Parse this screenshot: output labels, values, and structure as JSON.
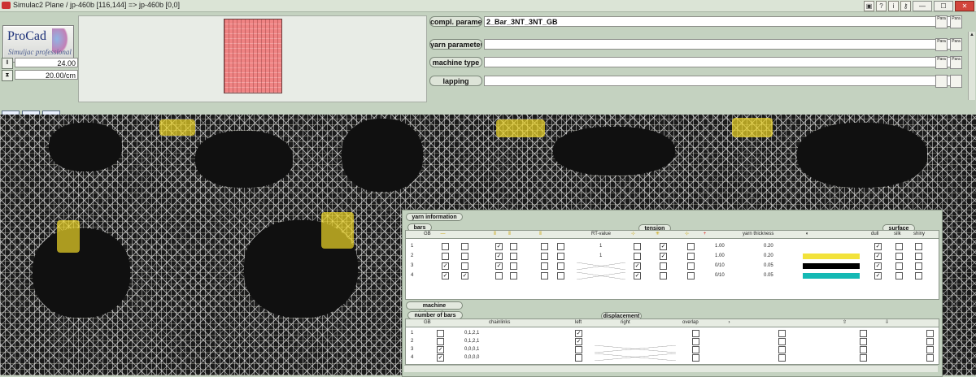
{
  "window": {
    "title": "Simulac2 Plane  / jp-460b [116,144] => jp-460b [0,0]",
    "toolbar_icons": [
      "save-icon",
      "help-icon",
      "info-icon",
      "key-icon"
    ],
    "buttons": {
      "minimize": "—",
      "maximize": "☐",
      "close": "✕"
    }
  },
  "logo": {
    "name": "ProCad",
    "subtitle": "Simuljac professional"
  },
  "params": [
    {
      "icon": "wale-icon",
      "value": "24.00"
    },
    {
      "icon": "course-icon",
      "value": "20.00/cm"
    }
  ],
  "fields": [
    {
      "label": "compl. parameter",
      "value": "2_Bar_3NT_3NT_GB"
    },
    {
      "label": "yarn parameter",
      "value": ""
    },
    {
      "label": "machine type",
      "value": ""
    },
    {
      "label": "lapping",
      "value": ""
    }
  ],
  "file_buttons": {
    "open": "Para",
    "save": "Para"
  },
  "tools": [
    "stitch-view-icon",
    "bars-icon",
    "settings-gear-icon"
  ],
  "yarn_information": {
    "tab": "yarn information",
    "subtab": "bars",
    "group_tension": "tension",
    "group_surface": "surface",
    "headers": {
      "gb": "GB",
      "runin": "RT-value",
      "thickness": "yarn thickness",
      "dull": "dull",
      "silk": "silk",
      "shiny": "shiny"
    },
    "rows": [
      {
        "n": "1",
        "runin": "1",
        "tension": "1.00",
        "thick": "0.20",
        "color": "#ffffff"
      },
      {
        "n": "2",
        "runin": "1",
        "tension": "1.00",
        "thick": "0.20",
        "color": "#f2e23a"
      },
      {
        "n": "3",
        "runin": "",
        "tension": "0/10",
        "thick": "0.05",
        "color": "#000000"
      },
      {
        "n": "4",
        "runin": "",
        "tension": "0/10",
        "thick": "0.05",
        "color": "#15b9b4"
      }
    ]
  },
  "machine_information": {
    "tab": "machine information",
    "subtab": "number of bars",
    "group": "displacement",
    "headers": {
      "gb": "GB",
      "chainlinks": "chainlinks",
      "left": "left",
      "right": "right",
      "overlap": "overlap"
    },
    "rows": [
      {
        "n": "1",
        "chain": "0,1,2,1"
      },
      {
        "n": "2",
        "chain": "0,1,2,1"
      },
      {
        "n": "3",
        "chain": "0,0,0,1"
      },
      {
        "n": "4",
        "chain": "0,0,0,0"
      }
    ]
  }
}
